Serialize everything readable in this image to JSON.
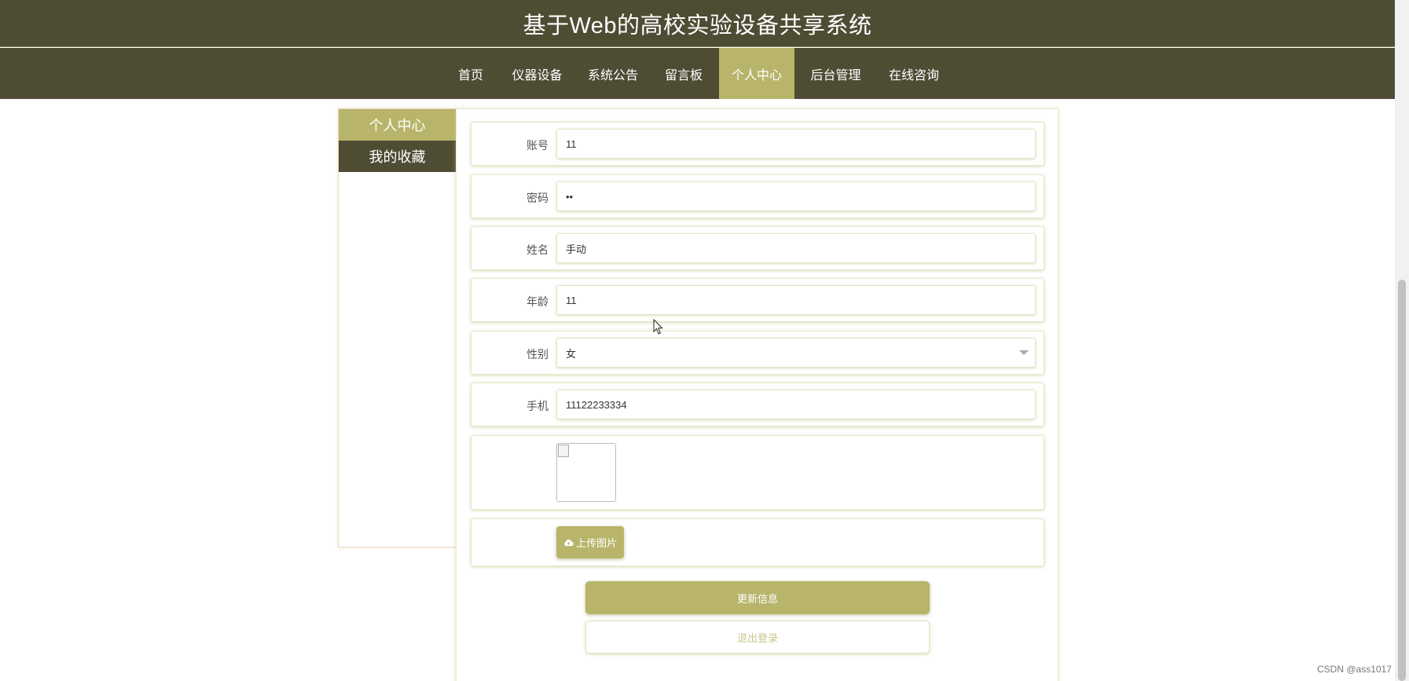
{
  "site": {
    "title": "基于Web的高校实验设备共享系统"
  },
  "nav": {
    "items": [
      {
        "label": "首页"
      },
      {
        "label": "仪器设备"
      },
      {
        "label": "系统公告"
      },
      {
        "label": "留言板"
      },
      {
        "label": "个人中心",
        "active": true
      },
      {
        "label": "后台管理"
      },
      {
        "label": "在线咨询"
      }
    ]
  },
  "side_menu": {
    "items": [
      {
        "label": "个人中心",
        "active": true
      },
      {
        "label": "我的收藏"
      }
    ]
  },
  "form": {
    "account": {
      "label": "账号",
      "value": "11"
    },
    "password": {
      "label": "密码",
      "value": "••"
    },
    "name": {
      "label": "姓名",
      "value": "手动"
    },
    "age": {
      "label": "年龄",
      "value": "11"
    },
    "gender": {
      "label": "性别",
      "value": "女"
    },
    "phone": {
      "label": "手机",
      "value": "11122233334"
    },
    "upload_label": "上传图片",
    "update_button": "更新信息",
    "logout_button": "退出登录"
  },
  "watermark": "CSDN @ass1017",
  "colors": {
    "header_bg": "#4f4c34",
    "accent": "#b8b56b",
    "logout_text": "#c9c68c"
  },
  "icons": [
    "chevron-down-icon",
    "cloud-upload-icon",
    "broken-image-icon",
    "mouse-cursor-icon"
  ]
}
